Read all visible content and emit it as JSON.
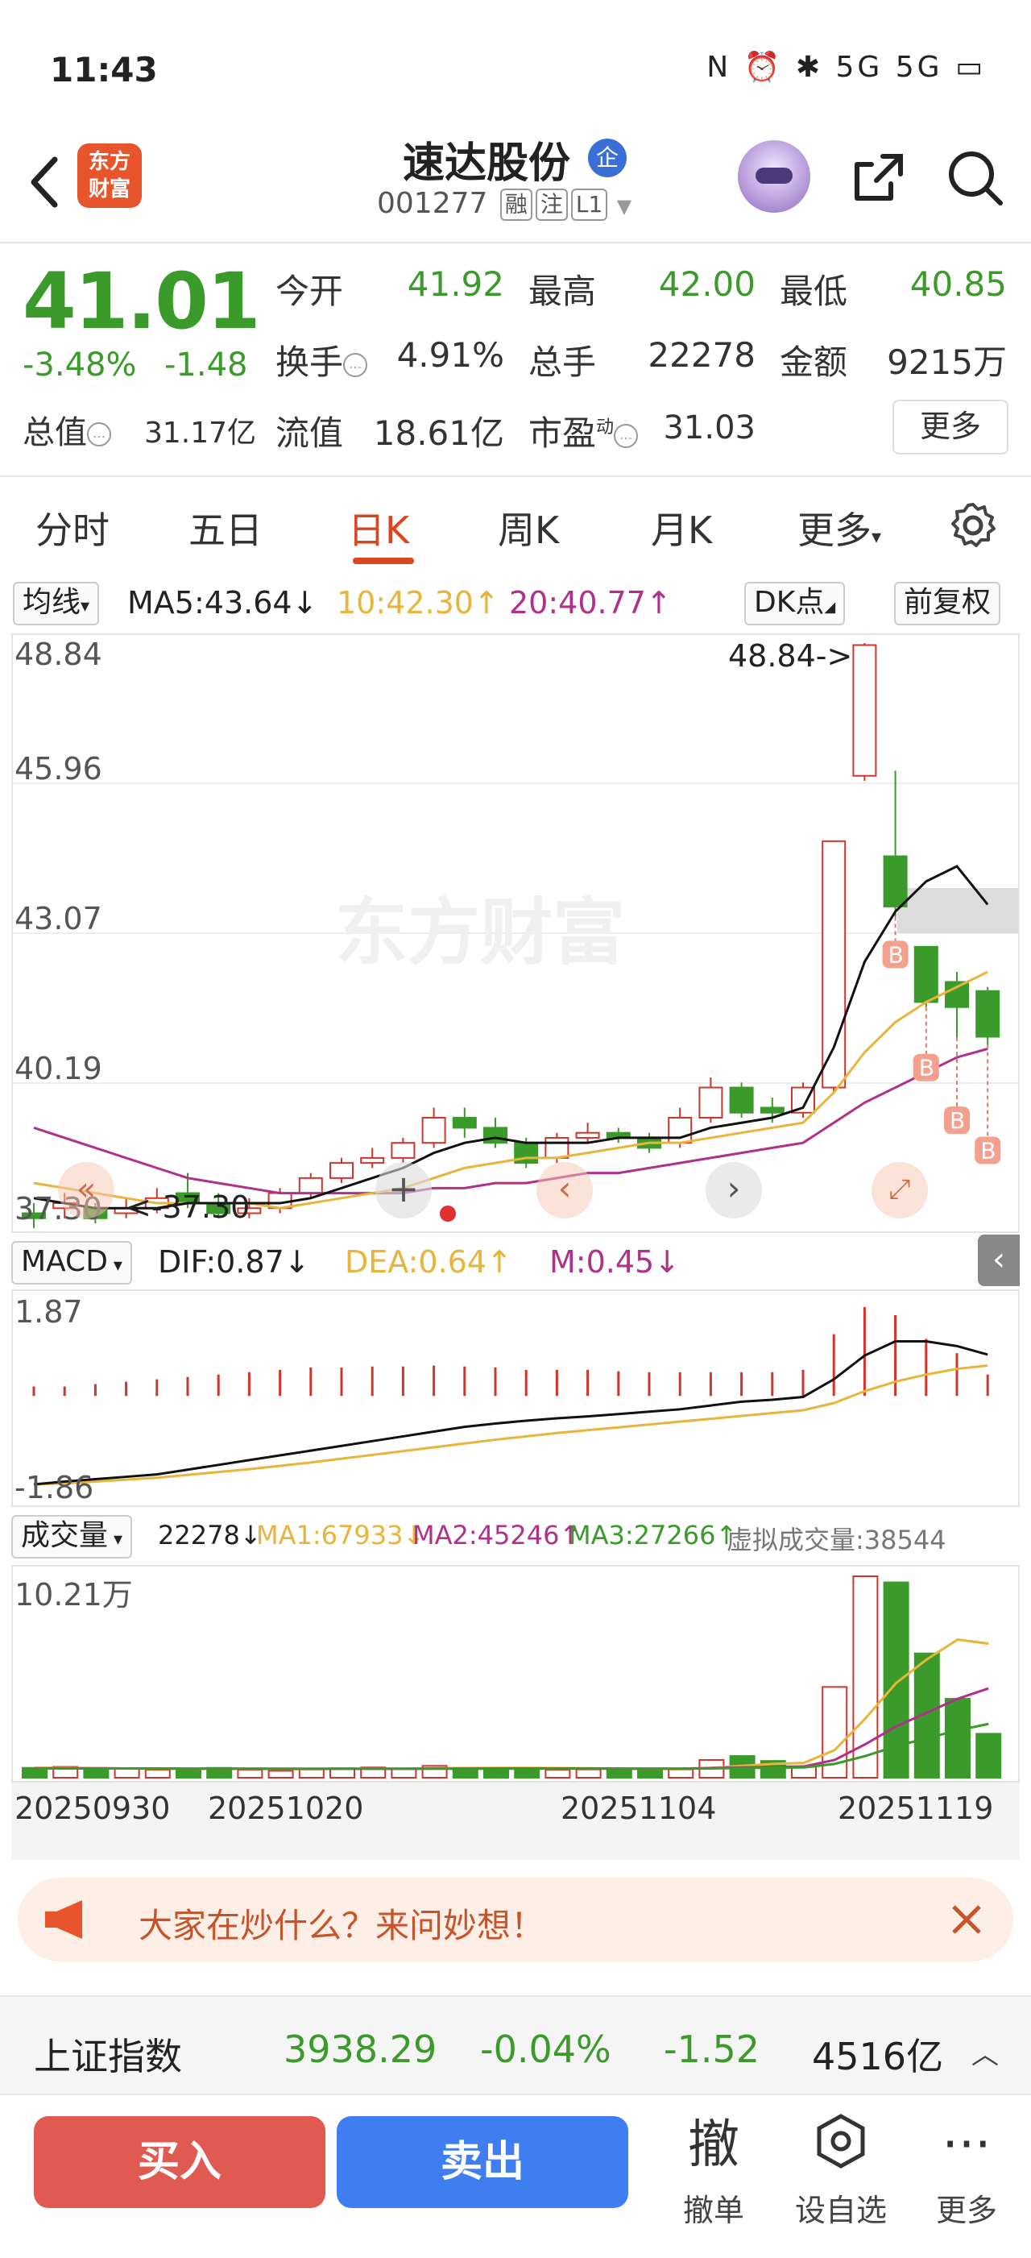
{
  "status_bar": {
    "time": "11:43",
    "icons_text": "N ⏰ ✱ 5G 5G ▭"
  },
  "header": {
    "stock_name": "速达股份",
    "qi_badge": "企",
    "code": "001277",
    "tags": [
      "融",
      "注",
      "L1"
    ],
    "logo_text": "东方财富"
  },
  "quote": {
    "price": "41.01",
    "change_pct": "-3.48%",
    "change_abs": "-1.48",
    "open_label": "今开",
    "open_value": "41.92",
    "high_label": "最高",
    "high_value": "42.00",
    "low_label": "最低",
    "low_value": "40.85",
    "turnover_label": "换手",
    "turnover_value": "4.91%",
    "total_vol_label": "总手",
    "total_vol_value": "22278",
    "amount_label": "金额",
    "amount_value": "9215万",
    "mktcap_label": "总值",
    "mktcap_value": "31.17亿",
    "float_label": "流值",
    "float_value": "18.61亿",
    "pe_label": "市盈",
    "pe_sup": "动",
    "pe_value": "31.03",
    "more_label": "更多"
  },
  "tabs": [
    "分时",
    "五日",
    "日K",
    "周K",
    "月K",
    "更多"
  ],
  "active_tab": "日K",
  "kline": {
    "ma_selector": "均线",
    "ma5": "MA5:43.64↓",
    "ma10": "10:42.30↑",
    "ma20": "20:40.77↑",
    "dk_label": "DK点",
    "adjust_label": "前复权",
    "y_labels": [
      "48.84",
      "45.96",
      "43.07",
      "40.19",
      "37.30"
    ],
    "high_marker": "48.84->",
    "low_marker": "<-37.30",
    "watermark": "东方财富",
    "b_marker": "B"
  },
  "macd": {
    "selector": "MACD",
    "dif": "DIF:0.87↓",
    "dea": "DEA:0.64↑",
    "m": "M:0.45↓",
    "y_top": "1.87",
    "y_bottom": "-1.86"
  },
  "volume": {
    "selector": "成交量",
    "value": "22278↓",
    "ma1": "MA1:67933↓",
    "ma2": "MA2:45246↑",
    "ma3": "MA3:27266↑",
    "virtual": "虚拟成交量:38544",
    "y_top": "10.21万",
    "dates": [
      "20250930",
      "20251020",
      "20251104",
      "20251119"
    ]
  },
  "colors": {
    "up": "#d0352c",
    "down": "#3a9a2a",
    "ma5": "#111111",
    "ma10": "#e8b43a",
    "ma20": "#b0308a",
    "accent": "#d9461f"
  },
  "banner": {
    "text": "大家在炒什么？来问妙想！"
  },
  "index_bar": {
    "name": "上证指数",
    "value": "3938.29",
    "pct": "-0.04%",
    "chg": "-1.52",
    "amount": "4516亿"
  },
  "bottom_bar": {
    "buy": "买入",
    "sell": "卖出",
    "cancel_glyph": "撤",
    "cancel": "撤单",
    "watch": "设自选",
    "more": "更多"
  }
}
